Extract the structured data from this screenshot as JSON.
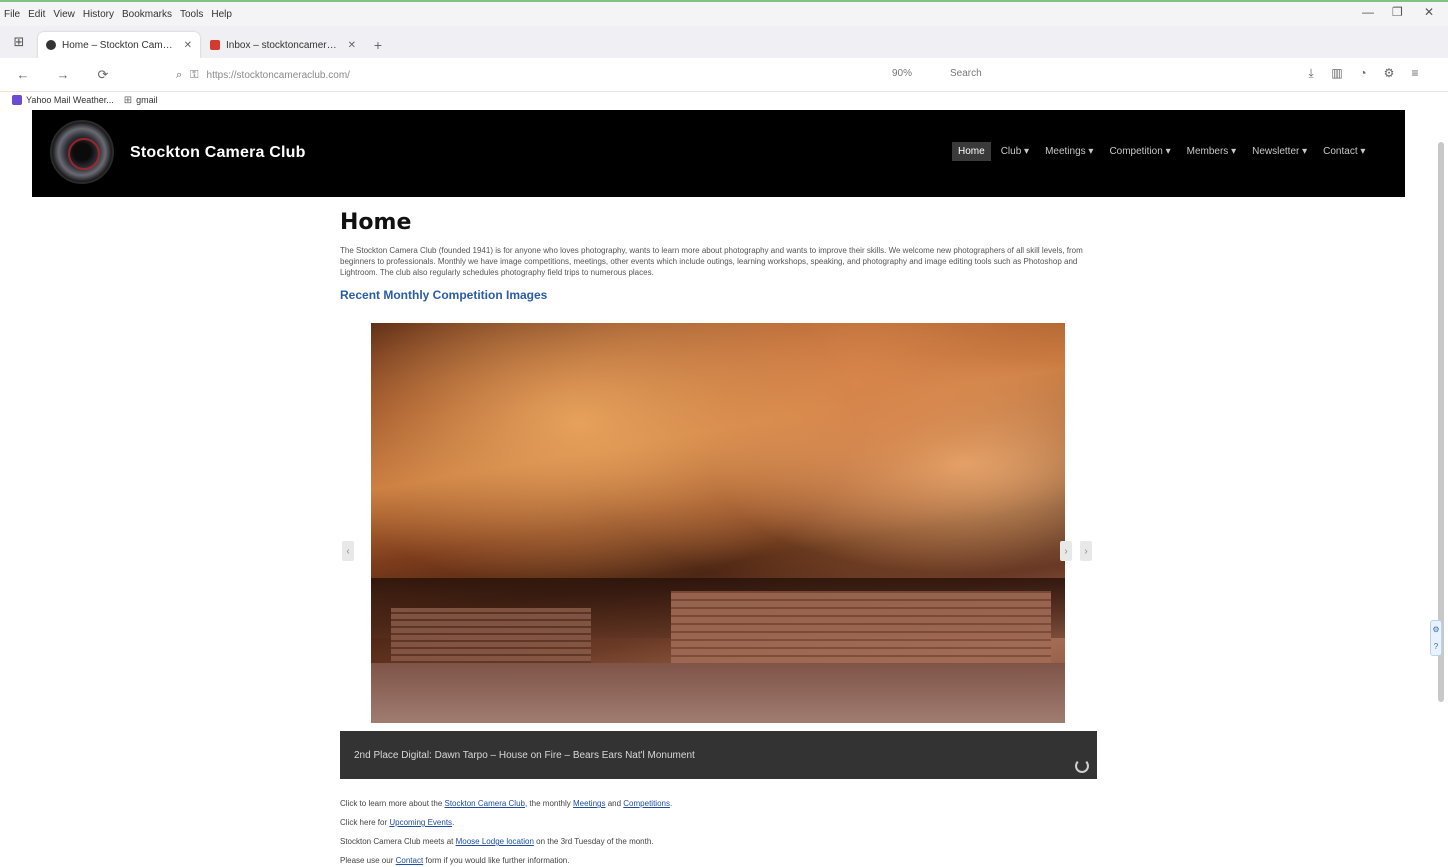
{
  "menubar": [
    "File",
    "Edit",
    "View",
    "History",
    "Bookmarks",
    "Tools",
    "Help"
  ],
  "window_controls": [
    "—",
    "❐",
    "✕"
  ],
  "tabs": [
    {
      "label": "Home – Stockton Camera Club",
      "close": "✕",
      "active": true
    },
    {
      "label": "Inbox – stocktoncameraclub@...",
      "close": "✕",
      "active": false
    }
  ],
  "new_tab": "+",
  "nav": {
    "back": "←",
    "forward": "→",
    "reload": "⟳",
    "url": "https://stocktoncameraclub.com/",
    "zoom": "90%",
    "search_placeholder": "Search"
  },
  "toolbar_icons": [
    "download-icon",
    "library-icon",
    "account-icon",
    "extensions-icon",
    "menu-icon"
  ],
  "bookmarks": [
    {
      "label": "Yahoo Mail Weather..."
    },
    {
      "label": "gmail"
    }
  ],
  "site": {
    "title": "Stockton Camera Club",
    "nav": [
      "Home",
      "Club ▾",
      "Meetings ▾",
      "Competition ▾",
      "Members ▾",
      "Newsletter ▾",
      "Contact ▾"
    ]
  },
  "content": {
    "heading": "Home",
    "intro": "The Stockton Camera Club (founded 1941) is for anyone who loves photography, wants to learn more about photography and wants to improve their skills. We welcome new photographers of all skill levels, from beginners to professionals. Monthly we have image competitions, meetings, other events which include outings, learning workshops, speaking, and photography and image editing tools such as Photoshop and Lightroom. The club also regularly schedules photography field trips to numerous places.",
    "recent_link": "Recent Monthly Competition Images",
    "slider_prev": "‹",
    "slider_next": "›",
    "caption": "2nd Place Digital: Dawn Tarpo – House on Fire – Bears Ears Nat'l Monument",
    "lines": [
      {
        "pre": "Click to learn more about the ",
        "link": "Stockton Camera Club",
        "mid": ", the monthly ",
        "link2": "Meetings",
        "mid2": " and ",
        "link3": "Competitions",
        "post": "."
      },
      {
        "pre": "Click here for ",
        "link": "Upcoming Events",
        "post": "."
      },
      {
        "pre": "Stockton Camera Club meets at ",
        "link": "Moose Lodge location",
        "post": " on the 3rd Tuesday of the month."
      },
      {
        "pre": "Please use our ",
        "link": "Contact",
        "post": " form if you would like further information."
      }
    ]
  }
}
